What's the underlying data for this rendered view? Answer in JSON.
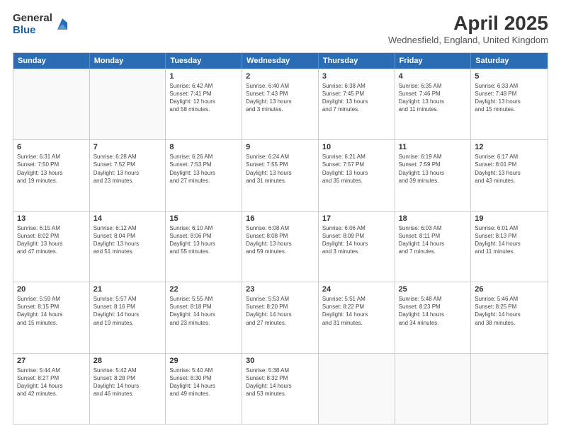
{
  "header": {
    "logo_general": "General",
    "logo_blue": "Blue",
    "month_year": "April 2025",
    "location": "Wednesfield, England, United Kingdom"
  },
  "days": [
    "Sunday",
    "Monday",
    "Tuesday",
    "Wednesday",
    "Thursday",
    "Friday",
    "Saturday"
  ],
  "rows": [
    [
      {
        "day": "",
        "empty": true
      },
      {
        "day": "",
        "empty": true
      },
      {
        "day": "1",
        "line1": "Sunrise: 6:42 AM",
        "line2": "Sunset: 7:41 PM",
        "line3": "Daylight: 12 hours",
        "line4": "and 58 minutes."
      },
      {
        "day": "2",
        "line1": "Sunrise: 6:40 AM",
        "line2": "Sunset: 7:43 PM",
        "line3": "Daylight: 13 hours",
        "line4": "and 3 minutes."
      },
      {
        "day": "3",
        "line1": "Sunrise: 6:38 AM",
        "line2": "Sunset: 7:45 PM",
        "line3": "Daylight: 13 hours",
        "line4": "and 7 minutes."
      },
      {
        "day": "4",
        "line1": "Sunrise: 6:35 AM",
        "line2": "Sunset: 7:46 PM",
        "line3": "Daylight: 13 hours",
        "line4": "and 11 minutes."
      },
      {
        "day": "5",
        "line1": "Sunrise: 6:33 AM",
        "line2": "Sunset: 7:48 PM",
        "line3": "Daylight: 13 hours",
        "line4": "and 15 minutes."
      }
    ],
    [
      {
        "day": "6",
        "line1": "Sunrise: 6:31 AM",
        "line2": "Sunset: 7:50 PM",
        "line3": "Daylight: 13 hours",
        "line4": "and 19 minutes."
      },
      {
        "day": "7",
        "line1": "Sunrise: 6:28 AM",
        "line2": "Sunset: 7:52 PM",
        "line3": "Daylight: 13 hours",
        "line4": "and 23 minutes."
      },
      {
        "day": "8",
        "line1": "Sunrise: 6:26 AM",
        "line2": "Sunset: 7:53 PM",
        "line3": "Daylight: 13 hours",
        "line4": "and 27 minutes."
      },
      {
        "day": "9",
        "line1": "Sunrise: 6:24 AM",
        "line2": "Sunset: 7:55 PM",
        "line3": "Daylight: 13 hours",
        "line4": "and 31 minutes."
      },
      {
        "day": "10",
        "line1": "Sunrise: 6:21 AM",
        "line2": "Sunset: 7:57 PM",
        "line3": "Daylight: 13 hours",
        "line4": "and 35 minutes."
      },
      {
        "day": "11",
        "line1": "Sunrise: 6:19 AM",
        "line2": "Sunset: 7:59 PM",
        "line3": "Daylight: 13 hours",
        "line4": "and 39 minutes."
      },
      {
        "day": "12",
        "line1": "Sunrise: 6:17 AM",
        "line2": "Sunset: 8:01 PM",
        "line3": "Daylight: 13 hours",
        "line4": "and 43 minutes."
      }
    ],
    [
      {
        "day": "13",
        "line1": "Sunrise: 6:15 AM",
        "line2": "Sunset: 8:02 PM",
        "line3": "Daylight: 13 hours",
        "line4": "and 47 minutes."
      },
      {
        "day": "14",
        "line1": "Sunrise: 6:12 AM",
        "line2": "Sunset: 8:04 PM",
        "line3": "Daylight: 13 hours",
        "line4": "and 51 minutes."
      },
      {
        "day": "15",
        "line1": "Sunrise: 6:10 AM",
        "line2": "Sunset: 8:06 PM",
        "line3": "Daylight: 13 hours",
        "line4": "and 55 minutes."
      },
      {
        "day": "16",
        "line1": "Sunrise: 6:08 AM",
        "line2": "Sunset: 8:08 PM",
        "line3": "Daylight: 13 hours",
        "line4": "and 59 minutes."
      },
      {
        "day": "17",
        "line1": "Sunrise: 6:06 AM",
        "line2": "Sunset: 8:09 PM",
        "line3": "Daylight: 14 hours",
        "line4": "and 3 minutes."
      },
      {
        "day": "18",
        "line1": "Sunrise: 6:03 AM",
        "line2": "Sunset: 8:11 PM",
        "line3": "Daylight: 14 hours",
        "line4": "and 7 minutes."
      },
      {
        "day": "19",
        "line1": "Sunrise: 6:01 AM",
        "line2": "Sunset: 8:13 PM",
        "line3": "Daylight: 14 hours",
        "line4": "and 11 minutes."
      }
    ],
    [
      {
        "day": "20",
        "line1": "Sunrise: 5:59 AM",
        "line2": "Sunset: 8:15 PM",
        "line3": "Daylight: 14 hours",
        "line4": "and 15 minutes."
      },
      {
        "day": "21",
        "line1": "Sunrise: 5:57 AM",
        "line2": "Sunset: 8:16 PM",
        "line3": "Daylight: 14 hours",
        "line4": "and 19 minutes."
      },
      {
        "day": "22",
        "line1": "Sunrise: 5:55 AM",
        "line2": "Sunset: 8:18 PM",
        "line3": "Daylight: 14 hours",
        "line4": "and 23 minutes."
      },
      {
        "day": "23",
        "line1": "Sunrise: 5:53 AM",
        "line2": "Sunset: 8:20 PM",
        "line3": "Daylight: 14 hours",
        "line4": "and 27 minutes."
      },
      {
        "day": "24",
        "line1": "Sunrise: 5:51 AM",
        "line2": "Sunset: 8:22 PM",
        "line3": "Daylight: 14 hours",
        "line4": "and 31 minutes."
      },
      {
        "day": "25",
        "line1": "Sunrise: 5:48 AM",
        "line2": "Sunset: 8:23 PM",
        "line3": "Daylight: 14 hours",
        "line4": "and 34 minutes."
      },
      {
        "day": "26",
        "line1": "Sunrise: 5:46 AM",
        "line2": "Sunset: 8:25 PM",
        "line3": "Daylight: 14 hours",
        "line4": "and 38 minutes."
      }
    ],
    [
      {
        "day": "27",
        "line1": "Sunrise: 5:44 AM",
        "line2": "Sunset: 8:27 PM",
        "line3": "Daylight: 14 hours",
        "line4": "and 42 minutes."
      },
      {
        "day": "28",
        "line1": "Sunrise: 5:42 AM",
        "line2": "Sunset: 8:28 PM",
        "line3": "Daylight: 14 hours",
        "line4": "and 46 minutes."
      },
      {
        "day": "29",
        "line1": "Sunrise: 5:40 AM",
        "line2": "Sunset: 8:30 PM",
        "line3": "Daylight: 14 hours",
        "line4": "and 49 minutes."
      },
      {
        "day": "30",
        "line1": "Sunrise: 5:38 AM",
        "line2": "Sunset: 8:32 PM",
        "line3": "Daylight: 14 hours",
        "line4": "and 53 minutes."
      },
      {
        "day": "",
        "empty": true
      },
      {
        "day": "",
        "empty": true
      },
      {
        "day": "",
        "empty": true
      }
    ]
  ]
}
